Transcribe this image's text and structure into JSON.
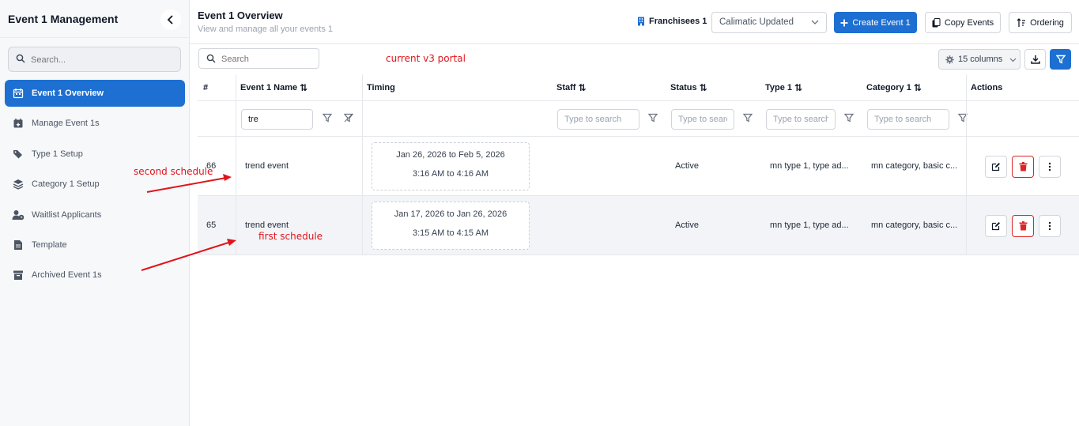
{
  "sidebar": {
    "title": "Event 1 Management",
    "search_placeholder": "Search...",
    "items": [
      {
        "label": "Event 1 Overview",
        "icon": "calendar-icon",
        "active": true
      },
      {
        "label": "Manage Event 1s",
        "icon": "calendar-plus-icon",
        "active": false
      },
      {
        "label": "Type 1 Setup",
        "icon": "tags-icon",
        "active": false
      },
      {
        "label": "Category 1 Setup",
        "icon": "layers-icon",
        "active": false
      },
      {
        "label": "Waitlist Applicants",
        "icon": "user-clock-icon",
        "active": false
      },
      {
        "label": "Template",
        "icon": "file-icon",
        "active": false
      },
      {
        "label": "Archived Event 1s",
        "icon": "archive-icon",
        "active": false
      }
    ]
  },
  "header": {
    "title": "Event 1 Overview",
    "subtitle": "View and manage all your events 1",
    "franchisee_label": "Franchisees 1",
    "franchisee_value": "Calimatic Updated",
    "create_label": "Create Event 1",
    "copy_label": "Copy Events",
    "ordering_label": "Ordering"
  },
  "toolbar": {
    "search_placeholder": "Search",
    "columns_label": "15 columns"
  },
  "annotations": {
    "portal": "current v3 portal",
    "second": "second schedule",
    "first": "first schedule"
  },
  "table": {
    "columns": [
      "#",
      "Event 1 Name",
      "Timing",
      "Staff",
      "Status",
      "Type 1",
      "Category 1",
      "Actions"
    ],
    "filters": {
      "name_value": "tre",
      "staff_placeholder": "Type to search",
      "status_placeholder": "Type to search",
      "type_placeholder": "Type to search",
      "category_placeholder": "Type to search"
    },
    "rows": [
      {
        "id": "66",
        "name": "trend event",
        "dates": "Jan 26, 2026 to Feb 5, 2026",
        "times": "3:16 AM to 4:16 AM",
        "staff": "",
        "status": "Active",
        "type": "mn type 1, type ad...",
        "category": "mn category, basic c..."
      },
      {
        "id": "65",
        "name": "trend event",
        "dates": "Jan 17, 2026 to Jan 26, 2026",
        "times": "3:15 AM to 4:15 AM",
        "staff": "",
        "status": "Active",
        "type": "mn type 1, type ad...",
        "category": "mn category, basic c..."
      }
    ]
  },
  "colors": {
    "primary": "#1d6fd1",
    "danger": "#dc2626",
    "annotation": "#e0141b"
  }
}
